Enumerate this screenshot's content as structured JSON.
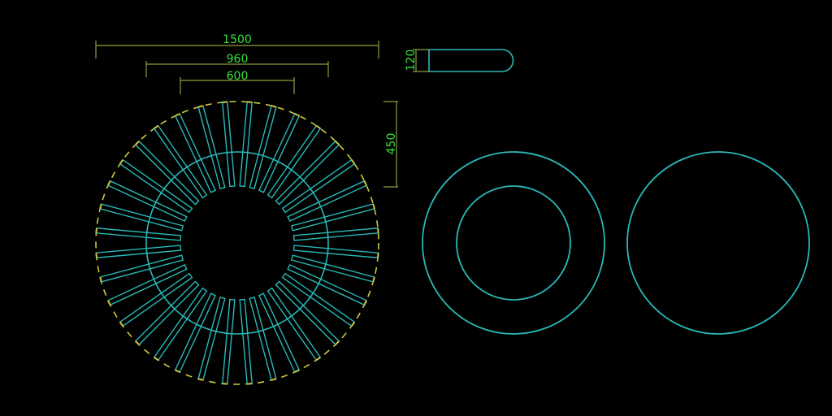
{
  "drawing": {
    "colors": {
      "background": "#000000",
      "geometry": "#2ab8b8",
      "dimension": "#8ca03c",
      "dimension_text": "#35e03a",
      "hidden_line": "#d2c83c"
    },
    "dimensions": {
      "overall": "1500",
      "middle": "960",
      "inner": "600",
      "height": "450",
      "profile": "120"
    },
    "slat_count": 36
  }
}
